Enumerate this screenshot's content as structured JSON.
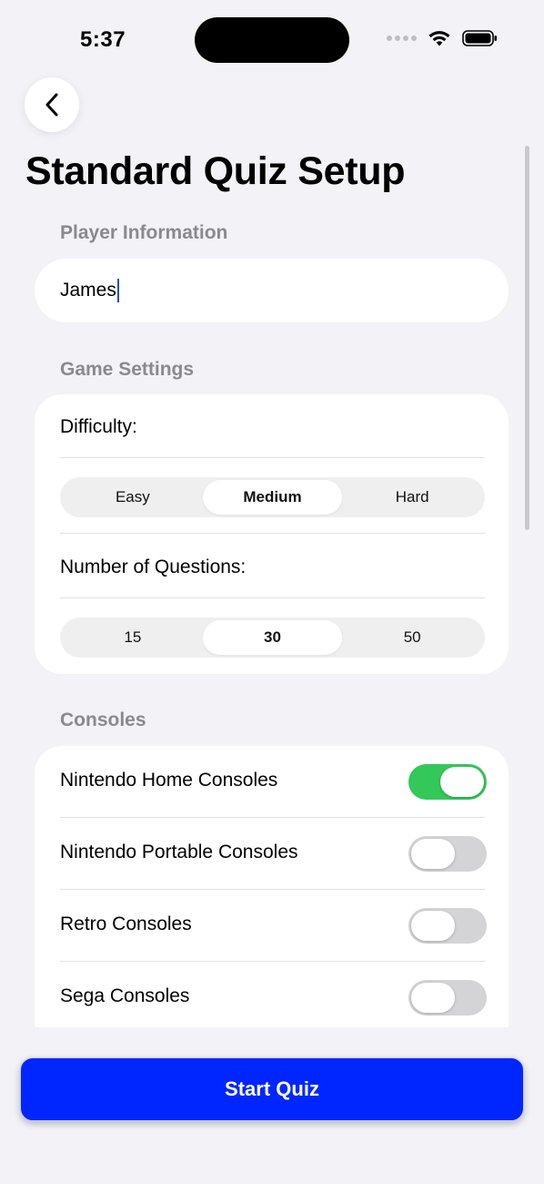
{
  "status_bar": {
    "time": "5:37"
  },
  "page": {
    "title": "Standard Quiz Setup"
  },
  "player_section": {
    "label": "Player Information",
    "name_value": "James"
  },
  "game_settings": {
    "label": "Game Settings",
    "difficulty_label": "Difficulty:",
    "difficulty_options": [
      "Easy",
      "Medium",
      "Hard"
    ],
    "difficulty_selected": "Medium",
    "questions_label": "Number of Questions:",
    "question_options": [
      "15",
      "30",
      "50"
    ],
    "questions_selected": "30"
  },
  "consoles": {
    "label": "Consoles",
    "items": [
      {
        "label": "Nintendo Home Consoles",
        "enabled": true
      },
      {
        "label": "Nintendo Portable Consoles",
        "enabled": false
      },
      {
        "label": "Retro Consoles",
        "enabled": false
      },
      {
        "label": "Sega Consoles",
        "enabled": false
      }
    ]
  },
  "actions": {
    "start_label": "Start Quiz"
  },
  "colors": {
    "accent": "#0026FF",
    "toggle_on": "#34C759",
    "background": "#F2F2F7"
  },
  "icons": {
    "back": "chevron-left-icon",
    "wifi": "wifi-icon",
    "battery": "battery-icon",
    "signal": "signal-icon"
  }
}
